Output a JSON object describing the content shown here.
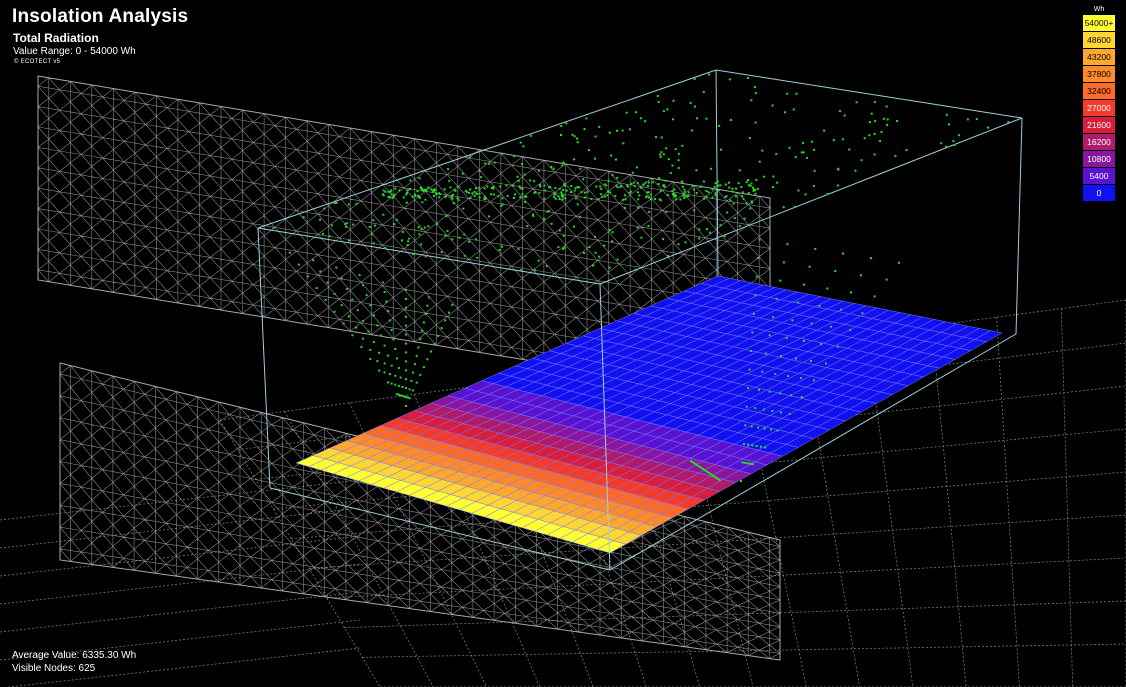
{
  "header": {
    "title": "Insolation Analysis",
    "subtitle": "Total Radiation",
    "value_range": "Value Range: 0 - 54000 Wh",
    "copyright": "© ECOTECT v5"
  },
  "stats": {
    "average": "Average Value: 6335.30 Wh",
    "visible_nodes": "Visible Nodes: 625"
  },
  "legend": {
    "unit": "Wh",
    "entries": [
      {
        "label": "54000+",
        "color": "#ffff33",
        "text": "#000000"
      },
      {
        "label": "48600",
        "color": "#ffd633",
        "text": "#000000"
      },
      {
        "label": "43200",
        "color": "#ffa82e",
        "text": "#000000"
      },
      {
        "label": "37800",
        "color": "#ff8a2a",
        "text": "#000000"
      },
      {
        "label": "32400",
        "color": "#ff6a26",
        "text": "#000000"
      },
      {
        "label": "27000",
        "color": "#f43a2a",
        "text": "#ffffff"
      },
      {
        "label": "21600",
        "color": "#d81e3c",
        "text": "#ffffff"
      },
      {
        "label": "16200",
        "color": "#b01a6a",
        "text": "#ffffff"
      },
      {
        "label": "10800",
        "color": "#8a16a0",
        "text": "#ffffff"
      },
      {
        "label": "5400",
        "color": "#5a12d2",
        "text": "#ffffff"
      },
      {
        "label": "0",
        "color": "#1010f0",
        "text": "#ffffff"
      }
    ]
  }
}
